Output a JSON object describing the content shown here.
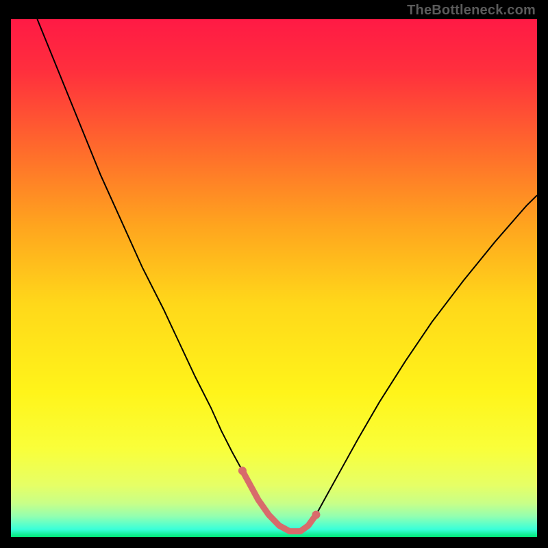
{
  "watermark": "TheBottleneck.com",
  "chart_data": {
    "type": "line",
    "title": "",
    "xlabel": "",
    "ylabel": "",
    "xlim": [
      0,
      100
    ],
    "ylim": [
      0,
      100
    ],
    "grid": false,
    "legend": false,
    "gradient": {
      "stops": [
        {
          "pos": 0.0,
          "color": "#ff1a45"
        },
        {
          "pos": 0.1,
          "color": "#ff2f3d"
        },
        {
          "pos": 0.25,
          "color": "#ff6a2c"
        },
        {
          "pos": 0.4,
          "color": "#ffa51e"
        },
        {
          "pos": 0.55,
          "color": "#ffd81a"
        },
        {
          "pos": 0.72,
          "color": "#fff41a"
        },
        {
          "pos": 0.83,
          "color": "#f9ff3a"
        },
        {
          "pos": 0.9,
          "color": "#e6ff66"
        },
        {
          "pos": 0.935,
          "color": "#c8ff88"
        },
        {
          "pos": 0.96,
          "color": "#93ffb0"
        },
        {
          "pos": 0.985,
          "color": "#3affda"
        },
        {
          "pos": 1.0,
          "color": "#00e676"
        }
      ]
    },
    "series": [
      {
        "name": "curve",
        "color": "#000000",
        "stroke_width": 2,
        "x": [
          5,
          9,
          13,
          17,
          21,
          25,
          29,
          32,
          35,
          38,
          40,
          42,
          44,
          45.5,
          47,
          49,
          51,
          53,
          55,
          56.5,
          58,
          60,
          63,
          66,
          70,
          75,
          80,
          86,
          92,
          98,
          100
        ],
        "y": [
          100,
          90,
          80,
          70,
          61,
          52,
          44,
          37.5,
          31,
          25,
          20.5,
          16.5,
          12.8,
          10,
          7.2,
          4.3,
          2.2,
          1.1,
          1.1,
          2.2,
          4.3,
          8,
          13.5,
          19,
          26,
          34,
          41.5,
          49.5,
          57,
          64,
          66
        ]
      },
      {
        "name": "highlight",
        "color": "#d86b6b",
        "stroke_width": 9,
        "linecap": "round",
        "x": [
          44,
          45.5,
          47,
          49,
          51,
          53,
          55,
          56.5,
          58
        ],
        "y": [
          12.8,
          10,
          7.2,
          4.3,
          2.2,
          1.1,
          1.1,
          2.2,
          4.3
        ]
      }
    ],
    "highlight_markers": {
      "color": "#d86b6b",
      "radius": 6,
      "points": [
        {
          "x": 44,
          "y": 12.8
        },
        {
          "x": 58,
          "y": 4.3
        }
      ]
    }
  }
}
